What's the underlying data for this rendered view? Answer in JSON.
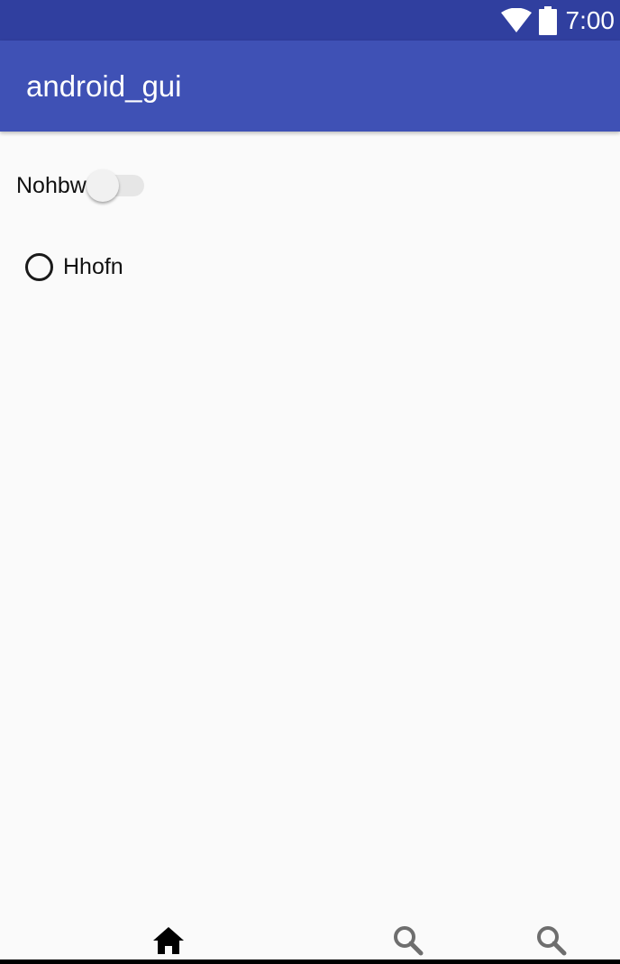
{
  "status_bar": {
    "time": "7:00",
    "icons": [
      "wifi-icon",
      "battery-icon"
    ],
    "background": "#303f9f"
  },
  "app_bar": {
    "title": "android_gui",
    "background": "#3f51b5"
  },
  "content": {
    "switch": {
      "label": "Nohbw",
      "checked": false
    },
    "radio": {
      "label": "Hhofn",
      "checked": false
    }
  },
  "bottom_nav": {
    "items": [
      {
        "icon": "home-icon",
        "active": true
      },
      {
        "icon": "search-icon",
        "active": false
      },
      {
        "icon": "search-icon",
        "active": false
      }
    ]
  }
}
